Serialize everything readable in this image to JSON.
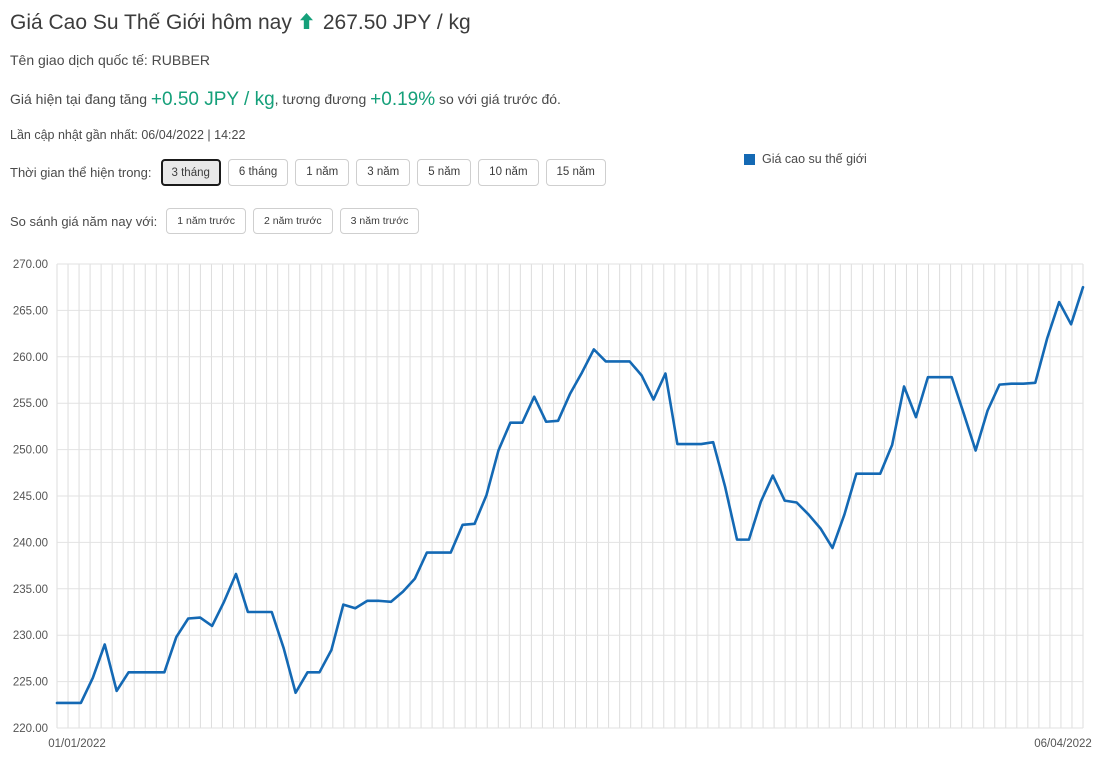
{
  "header": {
    "title": "Giá Cao Su Thế Giới hôm nay",
    "trend_icon": "arrow-up-icon",
    "trend_color": "#15a07a",
    "price": "267.50 JPY / kg",
    "symbol_line": "Tên giao dịch quốc tế: RUBBER",
    "change_prefix": "Giá hiện tại đang tăng",
    "change_value": "+0.50 JPY / kg",
    "change_mid": ", tương đương",
    "change_percent": "+0.19%",
    "change_suffix": "so với giá trước đó.",
    "updated": "Lần cập nhật gần nhất: 06/04/2022 | 14:22"
  },
  "controls": {
    "period_label": "Thời gian thể hiện trong:",
    "period_options": [
      "3 tháng",
      "6 tháng",
      "1 năm",
      "3 năm",
      "5 năm",
      "10 năm",
      "15 năm"
    ],
    "period_selected": "3 tháng",
    "compare_label": "So sánh giá năm nay với:",
    "compare_options": [
      "1 năm trước",
      "2 năm trước",
      "3 năm trước"
    ]
  },
  "legend": {
    "label": "Giá cao su thế giới",
    "color": "#1469b4"
  },
  "chart_data": {
    "type": "line",
    "title": "",
    "xlabel": "",
    "ylabel": "",
    "ylim": [
      220.0,
      270.0
    ],
    "yticks": [
      220.0,
      225.0,
      230.0,
      235.0,
      240.0,
      245.0,
      250.0,
      255.0,
      260.0,
      265.0,
      270.0
    ],
    "ytick_labels": [
      "220.00",
      "225.00",
      "230.00",
      "235.00",
      "240.00",
      "245.00",
      "250.00",
      "255.00",
      "260.00",
      "265.00",
      "270.00"
    ],
    "xtick_labels": [
      "01/01/2022",
      "06/04/2022"
    ],
    "x_start": "01/01/2022",
    "x_end": "06/04/2022",
    "grid": true,
    "line_color": "#1469b4",
    "line_width": 2.6,
    "series": [
      {
        "name": "Giá cao su thế giới",
        "values": [
          222.7,
          222.7,
          222.7,
          225.4,
          229.0,
          224.0,
          226.0,
          226.0,
          226.0,
          226.0,
          229.8,
          231.8,
          231.9,
          231.0,
          233.6,
          236.6,
          232.5,
          232.5,
          232.5,
          228.6,
          223.8,
          226.0,
          226.0,
          228.4,
          233.3,
          232.9,
          233.7,
          233.7,
          233.6,
          234.7,
          236.1,
          238.9,
          238.9,
          238.9,
          241.9,
          242.0,
          245.1,
          249.9,
          252.9,
          252.9,
          255.7,
          253.0,
          253.1,
          256.0,
          258.3,
          260.8,
          259.5,
          259.5,
          259.5,
          258.0,
          255.4,
          258.2,
          250.6,
          250.6,
          250.6,
          250.8,
          246.0,
          240.3,
          240.3,
          244.4,
          247.2,
          244.5,
          244.3,
          243.0,
          241.5,
          239.4,
          243.0,
          247.4,
          247.4,
          247.4,
          250.5,
          256.8,
          253.5,
          257.8,
          257.8,
          257.8,
          253.9,
          249.9,
          254.2,
          257.0,
          257.1,
          257.1,
          257.2,
          262.0,
          265.9,
          263.5,
          267.5
        ]
      }
    ]
  }
}
